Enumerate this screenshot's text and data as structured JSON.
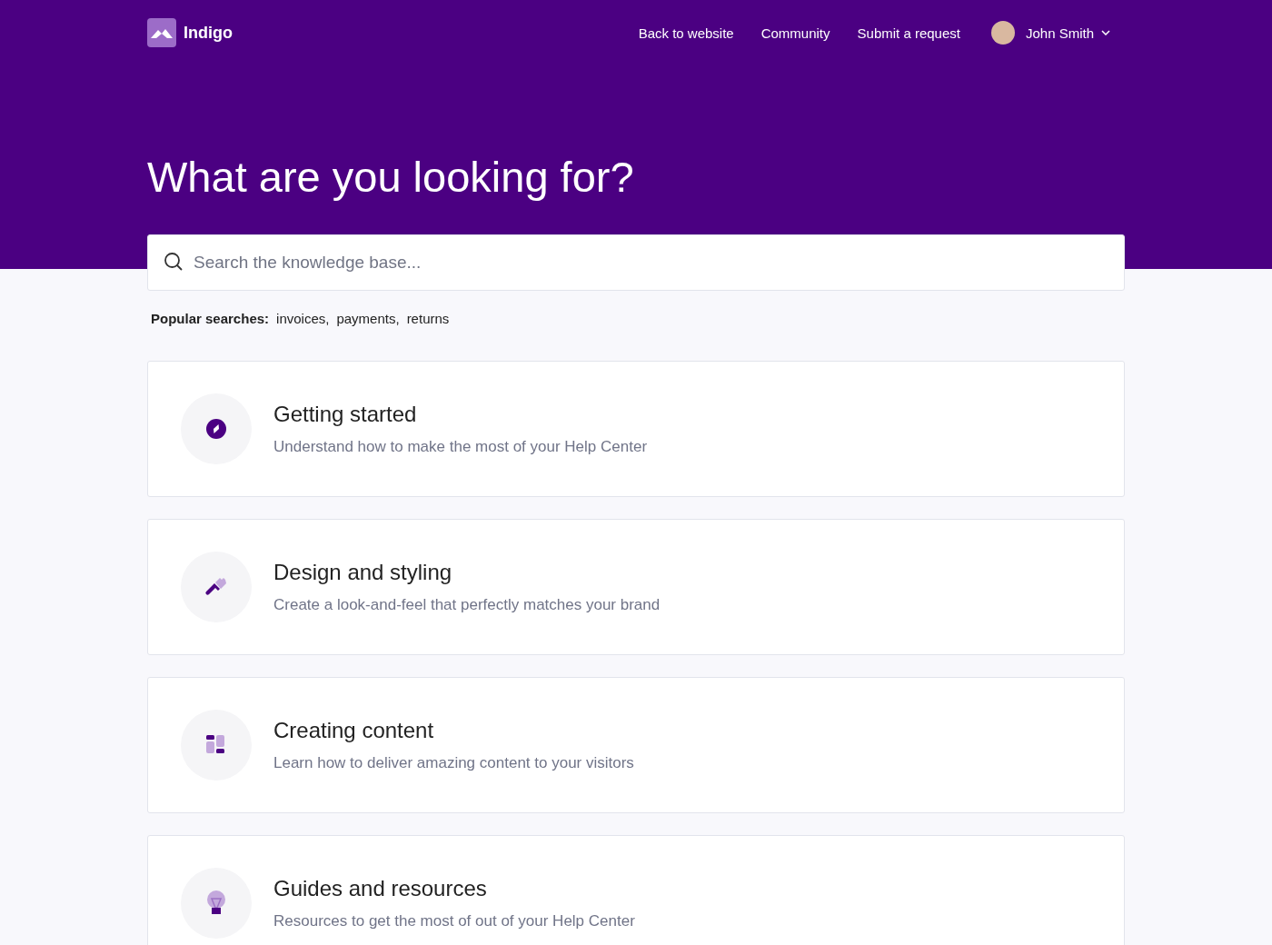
{
  "header": {
    "brand": "Indigo",
    "nav": [
      "Back to website",
      "Community",
      "Submit a request"
    ],
    "user": {
      "name": "John Smith"
    }
  },
  "hero": {
    "title": "What are you looking for?"
  },
  "search": {
    "placeholder": "Search the knowledge base..."
  },
  "popular": {
    "label": "Popular searches:",
    "terms": [
      "invoices,",
      "payments,",
      "returns"
    ]
  },
  "categories": [
    {
      "kind": "compass",
      "title": "Getting started",
      "description": "Understand how to make the most of your Help Center"
    },
    {
      "kind": "brush",
      "title": "Design and styling",
      "description": "Create a look-and-feel that perfectly matches your brand"
    },
    {
      "kind": "layout",
      "title": "Creating content",
      "description": "Learn how to deliver amazing content to your visitors"
    },
    {
      "kind": "bulb",
      "title": "Guides and resources",
      "description": "Resources to get the most of out of your Help Center"
    }
  ]
}
